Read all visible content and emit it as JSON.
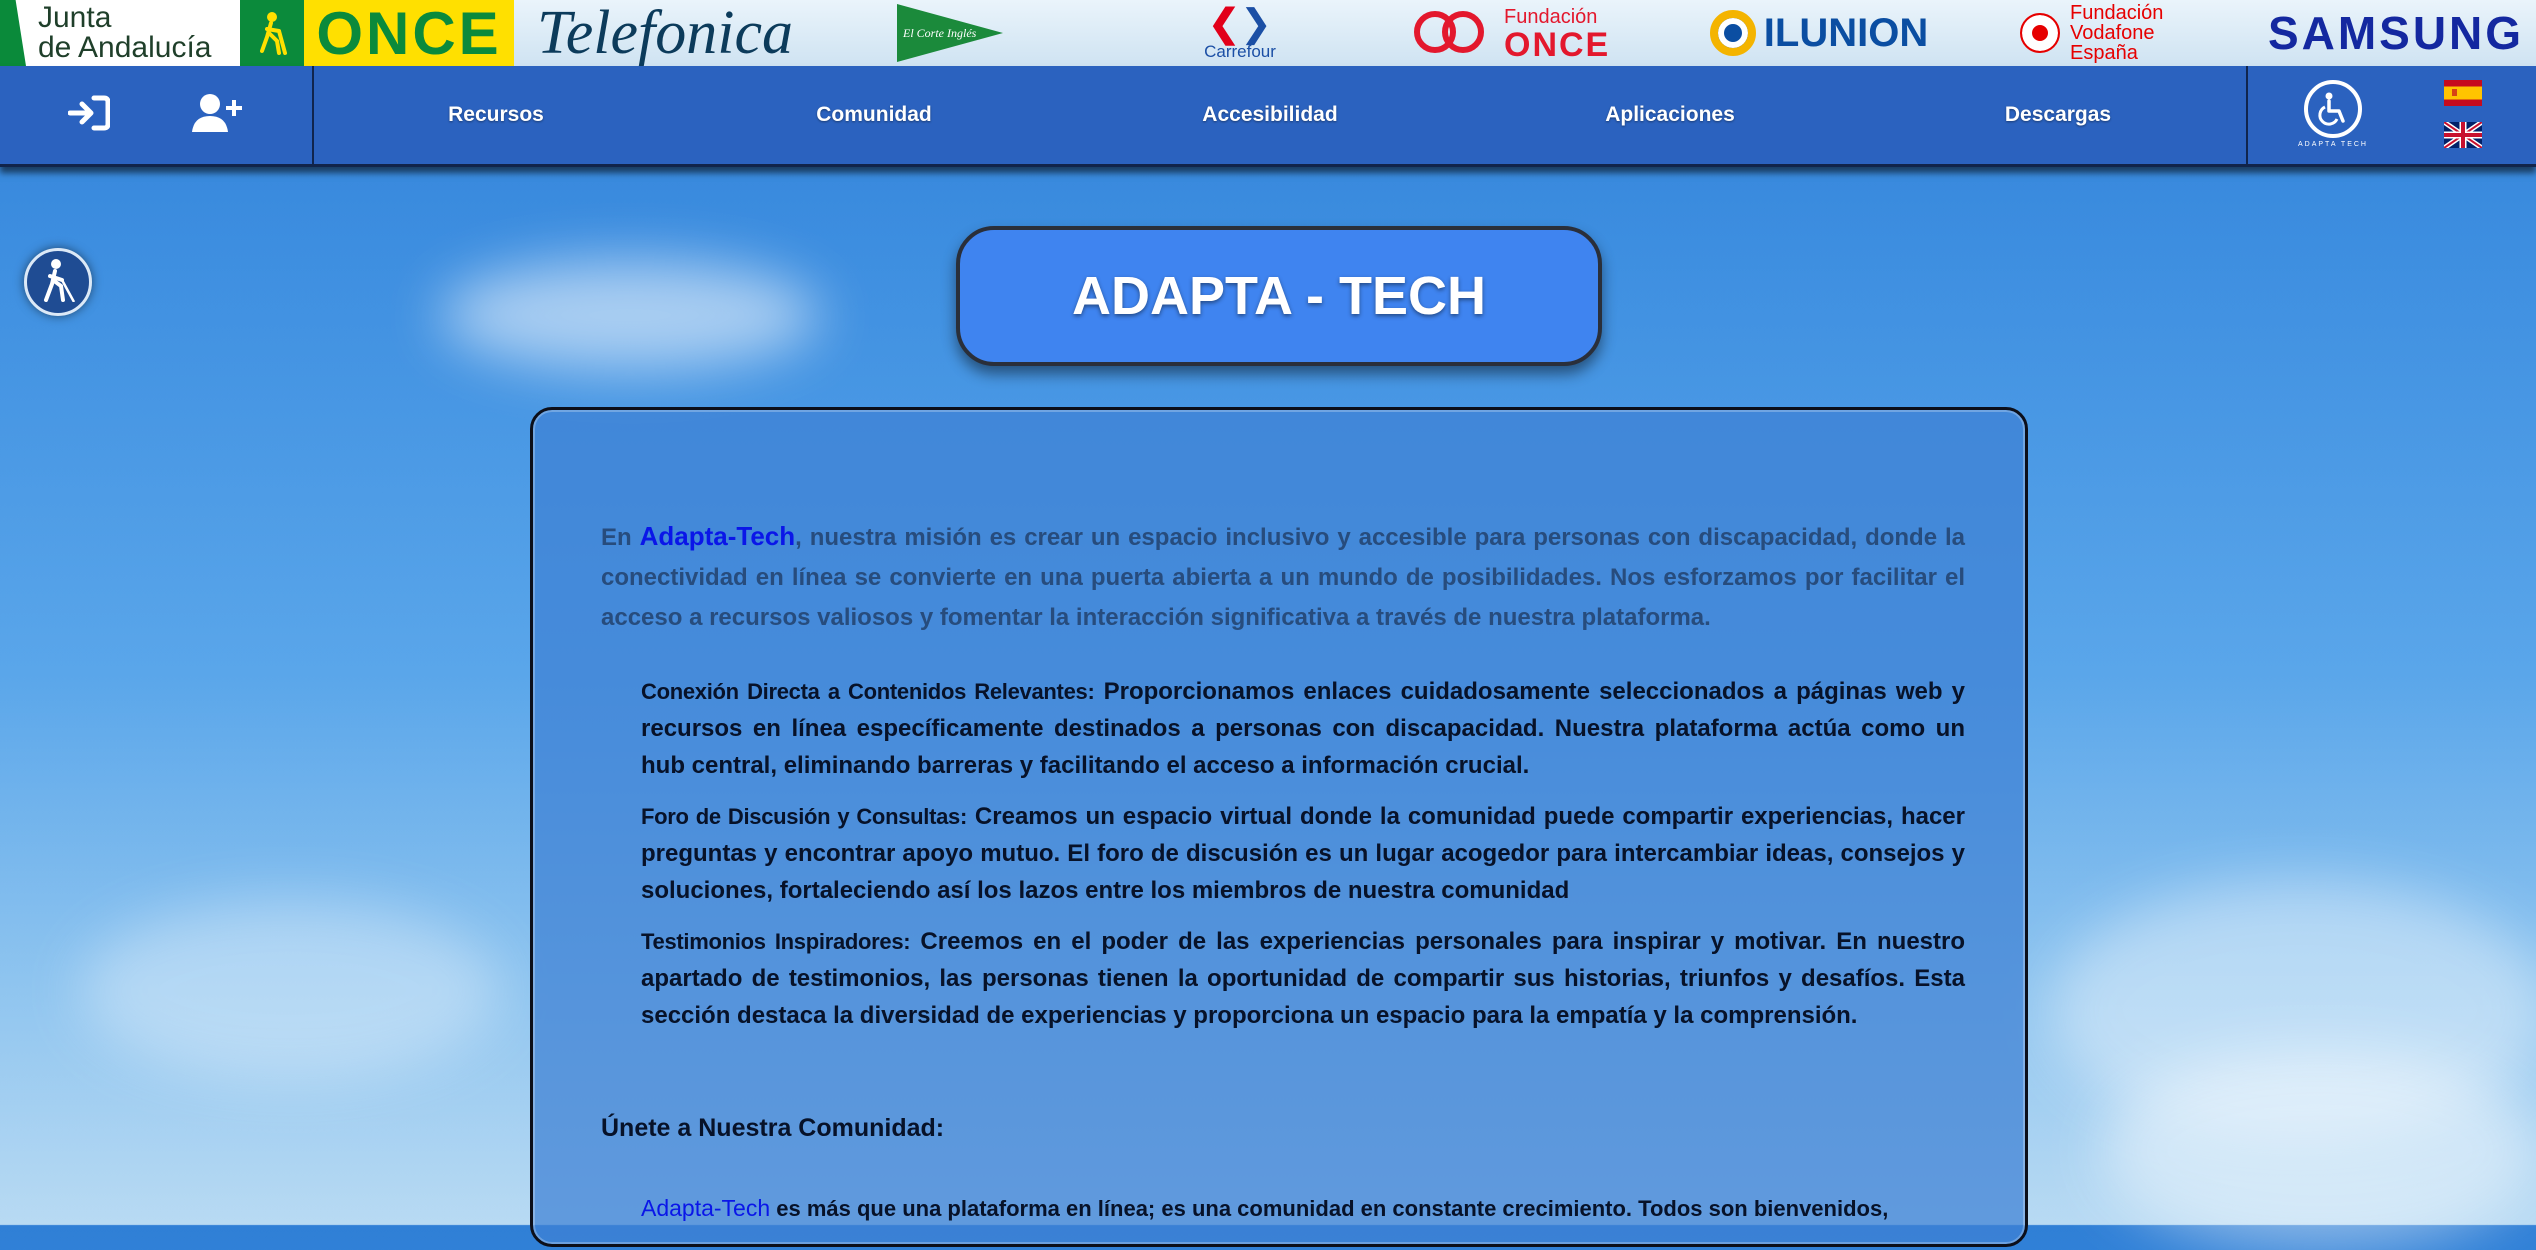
{
  "sponsors": {
    "junta_line1": "Junta",
    "junta_line2": "de Andalucía",
    "once": "ONCE",
    "telefonica": "Telefonica",
    "corte_ingles": "El Corte Inglés",
    "carrefour": "Carrefour",
    "fundacion_once_line1": "Fundación",
    "fundacion_once_line2": "ONCE",
    "ilunion": "ILUNION",
    "vodafone_line1": "Fundación",
    "vodafone_line2": "Vodafone",
    "vodafone_line3": "España",
    "samsung": "SAMSUNG"
  },
  "nav": {
    "login_icon": "sign-in-icon",
    "register_icon": "user-plus-icon",
    "links": [
      "Recursos",
      "Comunidad",
      "Accesibilidad",
      "Aplicaciones",
      "Descargas"
    ],
    "brand_text": "ADAPTA TECH",
    "flags": [
      "spain-flag-icon",
      "uk-flag-icon"
    ],
    "bg_color": "#2b62bf"
  },
  "accessibility_button_icon": "blind-person-icon",
  "title": "ADAPTA - TECH",
  "intro": {
    "prefix": "En ",
    "brand": "Adapta-Tech",
    "text": ", nuestra misión es crear un espacio inclusivo y accesible para personas con discapacidad, donde la conectividad en línea se convierte en una puerta abierta a un mundo de posibilidades. Nos esforzamos por facilitar el acceso a recursos valiosos y fomentar la interacción significativa a través de nuestra plataforma."
  },
  "features": [
    {
      "label": "Conexión Directa a Contenidos Relevantes:",
      "text": " Proporcionamos enlaces cuidadosamente seleccionados a páginas web y recursos en línea específicamente destinados a personas con discapacidad. Nuestra plataforma actúa como un hub central, eliminando barreras y facilitando el acceso a información crucial."
    },
    {
      "label": "Foro de Discusión y Consultas:",
      "text": " Creamos un espacio virtual donde la comunidad puede compartir experiencias, hacer preguntas y encontrar apoyo mutuo. El foro de discusión es un lugar acogedor para intercambiar ideas, consejos y soluciones, fortaleciendo así los lazos entre los miembros de nuestra comunidad"
    },
    {
      "label": "Testimonios Inspiradores:",
      "text": " Creemos en el poder de las experiencias personales para inspirar y motivar. En nuestro apartado de testimonios, las personas tienen la oportunidad de compartir sus historias, triunfos y desafíos. Esta sección destaca la diversidad de experiencias y proporciona un espacio para la empatía y la comprensión."
    }
  ],
  "join_heading": "Únete a Nuestra Comunidad:",
  "closing": {
    "brand": "Adapta-Tech",
    "text": " es más que una plataforma en línea; es una comunidad en constante crecimiento. Todos son bienvenidos,"
  }
}
